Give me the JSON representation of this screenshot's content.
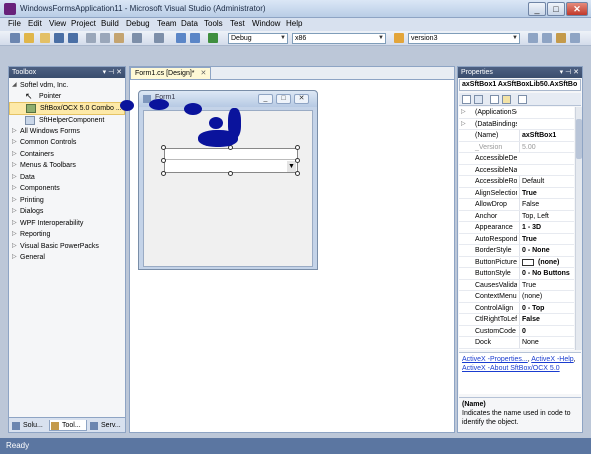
{
  "window": {
    "title": "WindowsFormsApplication11 - Microsoft Visual Studio (Administrator)",
    "controls": {
      "minimize": "_",
      "maximize": "□",
      "close": "✕"
    }
  },
  "menu": [
    "File",
    "Edit",
    "View",
    "Project",
    "Build",
    "Debug",
    "Team",
    "Data",
    "Tools",
    "Test",
    "Window",
    "Help"
  ],
  "toolbar": {
    "config": "Debug",
    "platform": "x86",
    "find": "version3"
  },
  "toolbox": {
    "title": "Toolbox",
    "items": [
      {
        "label": "Softel vdm, Inc.",
        "kind": "group-open"
      },
      {
        "label": "Pointer",
        "kind": "sub",
        "icon": "pointer-icon"
      },
      {
        "label": "SftBox/OCX 5.0 Combo ...",
        "kind": "sub",
        "icon": "combo-icon",
        "selected": true
      },
      {
        "label": "SftHelperComponent",
        "kind": "sub",
        "icon": "component-icon"
      },
      {
        "label": "All Windows Forms",
        "kind": "group"
      },
      {
        "label": "Common Controls",
        "kind": "group"
      },
      {
        "label": "Containers",
        "kind": "group"
      },
      {
        "label": "Menus & Toolbars",
        "kind": "group"
      },
      {
        "label": "Data",
        "kind": "group"
      },
      {
        "label": "Components",
        "kind": "group"
      },
      {
        "label": "Printing",
        "kind": "group"
      },
      {
        "label": "Dialogs",
        "kind": "group"
      },
      {
        "label": "WPF Interoperability",
        "kind": "group"
      },
      {
        "label": "Reporting",
        "kind": "group"
      },
      {
        "label": "Visual Basic PowerPacks",
        "kind": "group"
      },
      {
        "label": "General",
        "kind": "group"
      }
    ],
    "bottom_tabs": [
      "Solu...",
      "Tool...",
      "Serv..."
    ]
  },
  "document": {
    "tab": "Form1.cs [Design]*",
    "form_title": "Form1"
  },
  "properties": {
    "title": "Properties",
    "object": "axSftBox1 AxSftBoxLib50.AxSftBo",
    "rows": [
      {
        "name": "(ApplicationSe",
        "value": "",
        "expand": true
      },
      {
        "name": "(DataBindings",
        "value": "",
        "expand": true
      },
      {
        "name": "(Name)",
        "value": "axSftBox1",
        "bold": true
      },
      {
        "name": "_Version",
        "value": "5.00",
        "grey": true
      },
      {
        "name": "AccessibleDes",
        "value": ""
      },
      {
        "name": "AccessibleNar",
        "value": ""
      },
      {
        "name": "AccessibleRol",
        "value": "Default"
      },
      {
        "name": "AlignSelection",
        "value": "True",
        "bold": true
      },
      {
        "name": "AllowDrop",
        "value": "False"
      },
      {
        "name": "Anchor",
        "value": "Top, Left"
      },
      {
        "name": "Appearance",
        "value": "1 - 3D",
        "bold": true
      },
      {
        "name": "AutoRespond",
        "value": "True",
        "bold": true
      },
      {
        "name": "BorderStyle",
        "value": "0 - None",
        "bold": true
      },
      {
        "name": "ButtonPicture",
        "value": "(none)",
        "bold": true
      },
      {
        "name": "ButtonStyle",
        "value": "0 - No Buttons",
        "bold": true
      },
      {
        "name": "CausesValidat",
        "value": "True"
      },
      {
        "name": "ContextMenu",
        "value": "(none)"
      },
      {
        "name": "ControlAlign",
        "value": "0 - Top",
        "bold": true
      },
      {
        "name": "CtlRightToLef",
        "value": "False",
        "bold": true
      },
      {
        "name": "CustomCode",
        "value": "0",
        "bold": true
      },
      {
        "name": "Dock",
        "value": "None"
      }
    ],
    "links": {
      "l1": "ActiveX -Properties...",
      "l2": "ActiveX -Help",
      "l3": "ActiveX -About SftBox/OCX 5.0"
    },
    "desc_title": "(Name)",
    "desc_text": "Indicates the name used in code to identify the object."
  },
  "status": "Ready",
  "colors": {
    "accent": "#0a139c",
    "header": "#3a4d6d",
    "status": "#5b76a1"
  }
}
